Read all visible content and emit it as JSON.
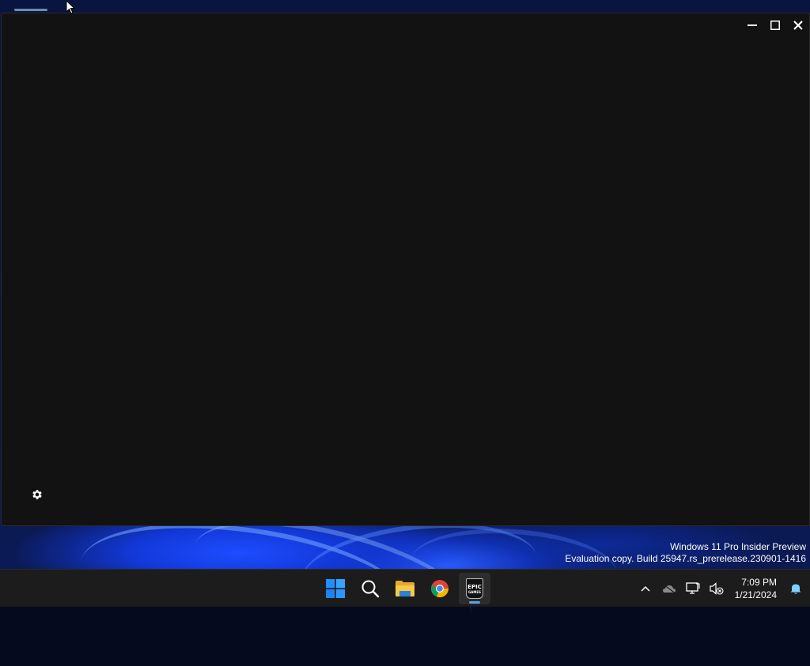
{
  "window": {
    "controls": {
      "minimize_icon": "minimize-icon",
      "maximize_icon": "maximize-icon",
      "close_icon": "close-icon"
    },
    "background": "#121212",
    "settings_icon": "gear-icon"
  },
  "watermark": {
    "line1": "Windows 11 Pro Insider Preview",
    "line2": "Evaluation copy. Build 25947.rs_prerelease.230901-1416"
  },
  "taskbar": {
    "apps": [
      {
        "name": "Start",
        "icon": "windows-logo-icon"
      },
      {
        "name": "Search",
        "icon": "search-icon"
      },
      {
        "name": "File Explorer",
        "icon": "folder-icon"
      },
      {
        "name": "Google Chrome",
        "icon": "chrome-icon"
      },
      {
        "name": "Epic Games Launcher",
        "icon": "epic-games-icon",
        "active": true,
        "logo_text": "EPIC",
        "logo_subtext": "GAMES"
      }
    ],
    "tray": {
      "icons": [
        "chevron-up-icon",
        "onedrive-offline-icon",
        "network-icon",
        "volume-muted-icon"
      ],
      "time": "7:09 PM",
      "date": "1/21/2024",
      "notification_icon": "bell-icon"
    }
  },
  "colors": {
    "taskbar_bg": "#1c1c1c",
    "accent": "#5aa0e6",
    "windows_blue": "#1e90ff"
  }
}
